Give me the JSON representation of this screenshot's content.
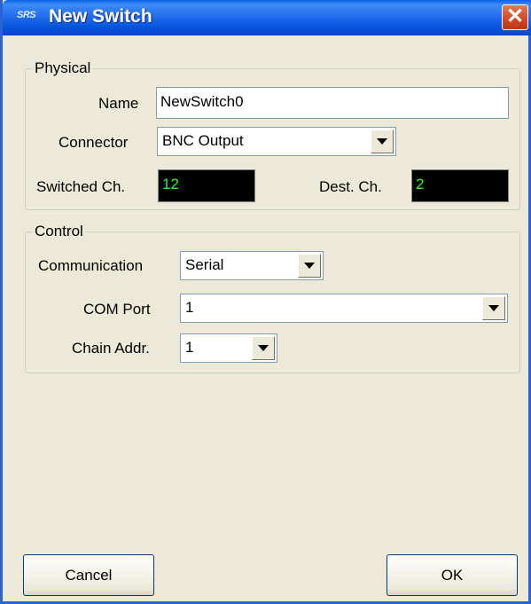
{
  "window": {
    "title": "New Switch",
    "logo_text": "SRS",
    "close_symbol": "✕"
  },
  "physical": {
    "legend": "Physical",
    "name_label": "Name",
    "name_value": "NewSwitch0",
    "connector_label": "Connector",
    "connector_value": "BNC Output",
    "switched_label": "Switched Ch.",
    "switched_value": "12",
    "dest_label": "Dest. Ch.",
    "dest_value": "2"
  },
  "control": {
    "legend": "Control",
    "communication_label": "Communication",
    "communication_value": "Serial",
    "com_port_label": "COM Port",
    "com_port_value": "1",
    "chain_label": "Chain Addr.",
    "chain_value": "1"
  },
  "buttons": {
    "cancel": "Cancel",
    "ok": "OK"
  },
  "colors": {
    "lcd_text": "#1aff1a",
    "titlebar": "#0855dd"
  }
}
